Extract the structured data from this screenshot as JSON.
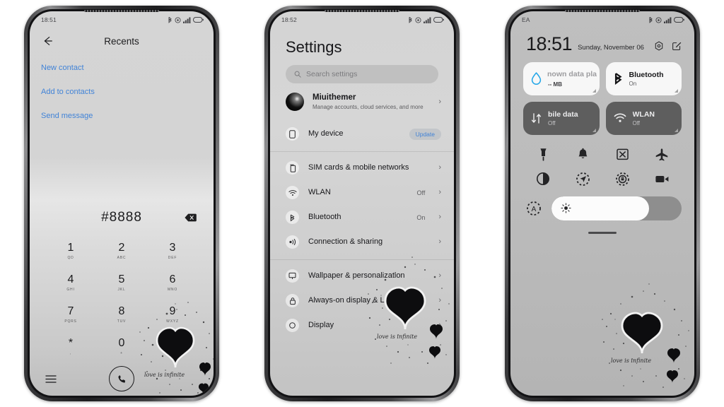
{
  "watermark": {
    "text": "love is infinite"
  },
  "phone1": {
    "name": "dialer-phone",
    "statusbar": {
      "time": "18:51",
      "icons": [
        "bluetooth-icon",
        "vibrate-icon",
        "signal-icon",
        "battery-icon"
      ]
    },
    "header": {
      "back": "back-arrow-icon",
      "title": "Recents"
    },
    "actions": [
      {
        "label": "New contact"
      },
      {
        "label": "Add to contacts"
      },
      {
        "label": "Send message"
      }
    ],
    "dialpad": {
      "number": "#8888",
      "delete_icon": "backspace-icon",
      "keys": [
        {
          "digit": "1",
          "letters": "QD"
        },
        {
          "digit": "2",
          "letters": "ABC"
        },
        {
          "digit": "3",
          "letters": "DEF"
        },
        {
          "digit": "4",
          "letters": "GHI"
        },
        {
          "digit": "5",
          "letters": "JKL"
        },
        {
          "digit": "6",
          "letters": "MNO"
        },
        {
          "digit": "7",
          "letters": "PQRS"
        },
        {
          "digit": "8",
          "letters": "TUV"
        },
        {
          "digit": "9",
          "letters": "WXYZ"
        },
        {
          "digit": "*",
          "letters": ","
        },
        {
          "digit": "0",
          "letters": "+"
        },
        {
          "digit": "#",
          "letters": ""
        }
      ]
    },
    "bottom": {
      "menu_icon": "menu-icon",
      "call_icon": "call-icon"
    },
    "accent_blue": "#4183d7"
  },
  "phone2": {
    "name": "settings-phone",
    "statusbar": {
      "time": "18:52",
      "icons": [
        "bluetooth-icon",
        "vibrate-icon",
        "signal-icon",
        "battery-icon"
      ]
    },
    "title": "Settings",
    "search": {
      "placeholder": "Search settings",
      "icon": "search-icon"
    },
    "account": {
      "name": "Miuithemer",
      "subtitle": "Manage accounts, cloud services, and more",
      "chevron": "chevron-right-icon"
    },
    "rows_group1": [
      {
        "icon": "phone-device-icon",
        "label": "My device",
        "badge": "Update",
        "value": "",
        "chevron": false
      }
    ],
    "rows_group2": [
      {
        "icon": "sim-card-icon",
        "label": "SIM cards & mobile networks",
        "value": "",
        "chevron": true
      },
      {
        "icon": "wifi-icon",
        "label": "WLAN",
        "value": "Off",
        "chevron": true
      },
      {
        "icon": "bluetooth-icon",
        "label": "Bluetooth",
        "value": "On",
        "chevron": true
      },
      {
        "icon": "connection-sharing-icon",
        "label": "Connection & sharing",
        "value": "",
        "chevron": true
      }
    ],
    "rows_group3": [
      {
        "icon": "wallpaper-icon",
        "label": "Wallpaper & personalization",
        "value": "",
        "chevron": true
      },
      {
        "icon": "lock-icon",
        "label": "Always-on display & Lock screen",
        "value": "",
        "chevron": true
      },
      {
        "icon": "display-icon",
        "label": "Display",
        "value": "",
        "chevron": true
      }
    ],
    "accent_blue": "#4183d7"
  },
  "phone3": {
    "name": "control-center-phone",
    "statusbar": {
      "carrier": "EA",
      "icons": [
        "bluetooth-icon",
        "vibrate-icon",
        "signal-icon",
        "battery-icon"
      ]
    },
    "clock": {
      "time": "18:51",
      "date": "Sunday, November 06",
      "settings_icon": "gear-icon",
      "edit_icon": "edit-icon"
    },
    "tiles": [
      {
        "icon": "data-usage-icon",
        "name": "nown data pla",
        "sub": "-- MB",
        "state": "on"
      },
      {
        "icon": "bluetooth-icon",
        "name": "Bluetooth",
        "sub": "On",
        "state": "on"
      },
      {
        "icon": "mobile-data-icon",
        "name": "bile data",
        "sub": "Off",
        "state": "off"
      },
      {
        "icon": "wifi-icon",
        "name": "WLAN",
        "sub": "Off",
        "state": "off"
      }
    ],
    "toggles_row1": [
      "flashlight-icon",
      "bell-icon",
      "screenshot-icon",
      "airplane-icon"
    ],
    "toggles_row2": [
      "dark-mode-icon",
      "location-icon",
      "rotation-lock-icon",
      "screen-record-icon"
    ],
    "brightness": {
      "auto_icon": "auto-brightness-icon",
      "slider_icon": "sun-icon",
      "level": 75
    }
  }
}
